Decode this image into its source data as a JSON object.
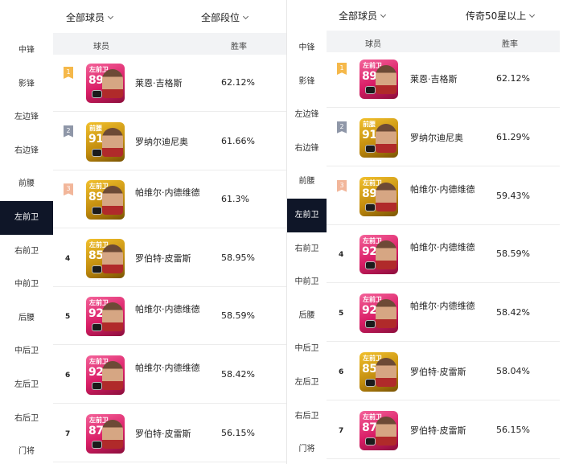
{
  "left_panel": {
    "filters": {
      "players": "全部球员",
      "tier": "全部段位"
    },
    "headers": {
      "player": "球员",
      "winrate": "胜率"
    },
    "sidebar": [
      "中锋",
      "影锋",
      "左边锋",
      "右边锋",
      "前腰",
      "左前卫",
      "右前卫",
      "中前卫",
      "后腰",
      "中后卫",
      "左后卫",
      "右后卫",
      "门将"
    ],
    "active_position": "左前卫",
    "rows": [
      {
        "rank": "1",
        "card_pos": "左前卫",
        "ovr": "89",
        "card_color": "pink",
        "name": "莱恩·吉格斯",
        "winrate": "62.12%"
      },
      {
        "rank": "2",
        "card_pos": "前腰",
        "ovr": "91",
        "card_color": "gold",
        "name": "罗纳尔迪尼奥",
        "winrate": "61.66%"
      },
      {
        "rank": "3",
        "card_pos": "左前卫",
        "ovr": "89",
        "card_color": "gold",
        "name": "帕维尔·内德维德",
        "winrate": "61.3%"
      },
      {
        "rank": "4",
        "card_pos": "左前卫",
        "ovr": "85",
        "card_color": "gold",
        "name": "罗伯特·皮雷斯",
        "winrate": "58.95%"
      },
      {
        "rank": "5",
        "card_pos": "左前卫",
        "ovr": "92",
        "card_color": "pink",
        "name": "帕维尔·内德维德",
        "winrate": "58.59%"
      },
      {
        "rank": "6",
        "card_pos": "左前卫",
        "ovr": "92",
        "card_color": "pink",
        "name": "帕维尔·内德维德",
        "winrate": "58.42%"
      },
      {
        "rank": "7",
        "card_pos": "左前卫",
        "ovr": "87",
        "card_color": "pink",
        "name": "罗伯特·皮雷斯",
        "winrate": "56.15%"
      }
    ]
  },
  "right_panel": {
    "filters": {
      "players": "全部球员",
      "tier": "传奇50星以上"
    },
    "headers": {
      "player": "球员",
      "winrate": "胜率"
    },
    "sidebar": [
      "中锋",
      "影锋",
      "左边锋",
      "右边锋",
      "前腰",
      "左前卫",
      "右前卫",
      "中前卫",
      "后腰",
      "中后卫",
      "左后卫",
      "右后卫",
      "门将"
    ],
    "active_position": "左前卫",
    "rows": [
      {
        "rank": "1",
        "card_pos": "左前卫",
        "ovr": "89",
        "card_color": "pink",
        "name": "莱恩·吉格斯",
        "winrate": "62.12%"
      },
      {
        "rank": "2",
        "card_pos": "前腰",
        "ovr": "91",
        "card_color": "gold",
        "name": "罗纳尔迪尼奥",
        "winrate": "61.29%"
      },
      {
        "rank": "3",
        "card_pos": "左前卫",
        "ovr": "89",
        "card_color": "gold",
        "name": "帕维尔·内德维德",
        "winrate": "59.43%"
      },
      {
        "rank": "4",
        "card_pos": "左前卫",
        "ovr": "92",
        "card_color": "pink",
        "name": "帕维尔·内德维德",
        "winrate": "58.59%"
      },
      {
        "rank": "5",
        "card_pos": "左前卫",
        "ovr": "92",
        "card_color": "pink",
        "name": "帕维尔·内德维德",
        "winrate": "58.42%"
      },
      {
        "rank": "6",
        "card_pos": "左前卫",
        "ovr": "85",
        "card_color": "gold",
        "name": "罗伯特·皮雷斯",
        "winrate": "58.04%"
      },
      {
        "rank": "7",
        "card_pos": "左前卫",
        "ovr": "87",
        "card_color": "pink",
        "name": "罗伯特·皮雷斯",
        "winrate": "56.15%"
      }
    ]
  },
  "colors": {
    "active_bg": "#0f1628",
    "rank1": "#f5b84a",
    "rank2": "#8f97a8",
    "rank3": "#f2b69a"
  }
}
